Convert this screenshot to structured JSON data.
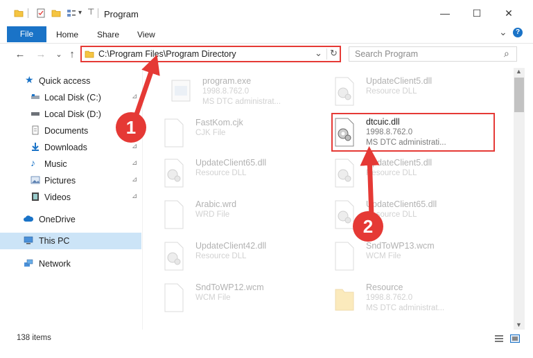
{
  "window": {
    "title": "Program",
    "minimize": "—",
    "maximize": "☐",
    "close": "✕"
  },
  "ribbon": {
    "tabs": [
      "File",
      "Home",
      "Share",
      "View"
    ],
    "collapse": "⌄",
    "help": "?"
  },
  "nav": {
    "back": "←",
    "forward": "→",
    "recent": "⌄",
    "up": "↑",
    "address": "C:\\Program Files\\Program Directory",
    "address_dropdown": "⌄",
    "refresh": "↻",
    "search_placeholder": "Search Program",
    "search_icon_glyph": "⌕"
  },
  "sidebar": {
    "items": [
      {
        "label": "Quick access",
        "icon": "star-icon"
      },
      {
        "label": "Local Disk (C:)",
        "icon": "drive-icon"
      },
      {
        "label": "Local Disk (D:)",
        "icon": "drive-icon"
      },
      {
        "label": "Documents",
        "icon": "document-icon"
      },
      {
        "label": "Downloads",
        "icon": "download-icon"
      },
      {
        "label": "Music",
        "icon": "music-icon"
      },
      {
        "label": "Pictures",
        "icon": "picture-icon"
      },
      {
        "label": "Videos",
        "icon": "video-icon"
      },
      {
        "label": "OneDrive",
        "icon": "cloud-icon"
      },
      {
        "label": "This PC",
        "icon": "computer-icon"
      },
      {
        "label": "Network",
        "icon": "network-icon"
      }
    ],
    "pin_glyph": "📌"
  },
  "files": [
    {
      "name": "program.exe",
      "line2": "1998.8.762.0",
      "line3": "MS DTC administrat...",
      "icon": "exe-icon"
    },
    {
      "name": "UpdateClient5.dll",
      "line2": "Resource DLL",
      "line3": "",
      "icon": "dll-icon"
    },
    {
      "name": "FastKom.cjk",
      "line2": "CJK File",
      "line3": "",
      "icon": "file-icon"
    },
    {
      "name": "dtcuic.dll",
      "line2": "1998.8.762.0",
      "line3": "MS DTC administrati...",
      "icon": "dll-icon"
    },
    {
      "name": "UpdateClient65.dll",
      "line2": "Resource DLL",
      "line3": "",
      "icon": "dll-icon"
    },
    {
      "name": "UpdateClient5.dll",
      "line2": "Resource DLL",
      "line3": "",
      "icon": "dll-icon"
    },
    {
      "name": "Arabic.wrd",
      "line2": "WRD File",
      "line3": "",
      "icon": "file-icon"
    },
    {
      "name": "UpdateClient65.dll",
      "line2": "Resource DLL",
      "line3": "",
      "icon": "dll-icon"
    },
    {
      "name": "UpdateClient42.dll",
      "line2": "Resource DLL",
      "line3": "",
      "icon": "dll-icon"
    },
    {
      "name": "SndToWP13.wcm",
      "line2": "WCM File",
      "line3": "",
      "icon": "file-icon"
    },
    {
      "name": "SndToWP12.wcm",
      "line2": "WCM File",
      "line3": "",
      "icon": "file-icon"
    },
    {
      "name": "Resource",
      "line2": "1998.8.762.0",
      "line3": "MS DTC administrat...",
      "icon": "folder-icon"
    }
  ],
  "status": {
    "count": "138 items"
  },
  "annotations": {
    "step1": "1",
    "step2": "2"
  },
  "colors": {
    "accent": "#1a73c7",
    "highlight": "#e53935",
    "selection": "#cce4f7"
  }
}
